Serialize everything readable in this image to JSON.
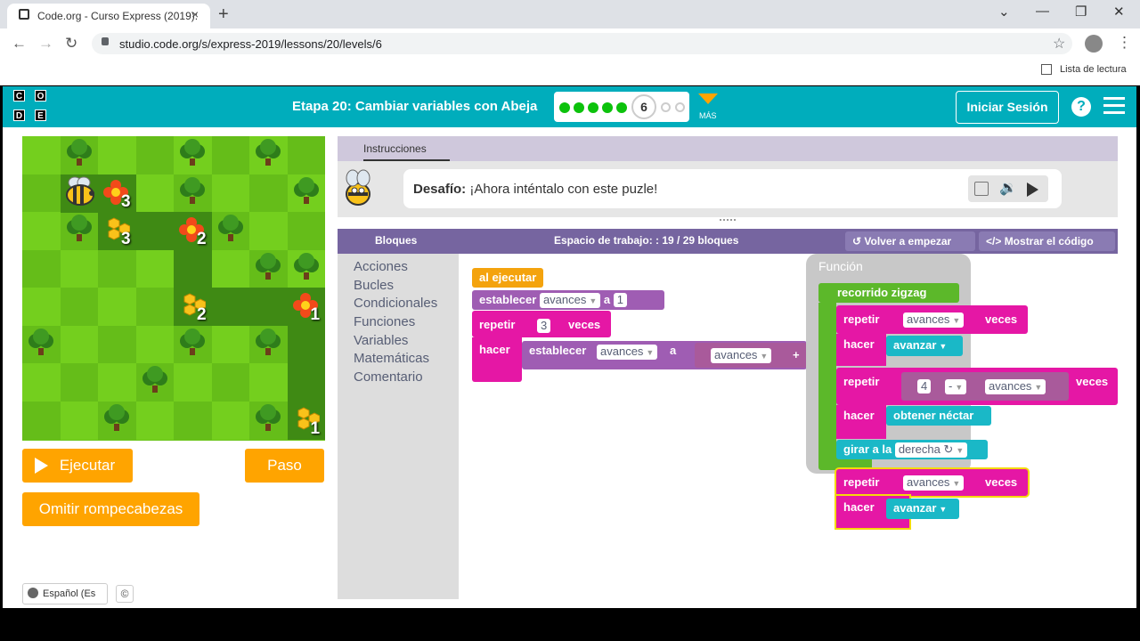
{
  "browser": {
    "tab_title": "Code.org - Curso Express (2019):",
    "tab_close": "×",
    "new_tab": "+",
    "url": "studio.code.org/s/express-2019/lessons/20/levels/6",
    "reading_list": "Lista de lectura",
    "window_controls": [
      "⌄",
      "—",
      "❐",
      "✕"
    ],
    "nav": [
      "←",
      "→",
      "↻"
    ]
  },
  "header": {
    "logo_letters": [
      "C",
      "O",
      "D",
      "E"
    ],
    "stage_title": "Etapa 20: Cambiar variables con Abeja",
    "progress_current": "6",
    "progress_completed": 5,
    "progress_remaining": 2,
    "more_label": "MÁS",
    "signin_label": "Iniciar Sesión",
    "help_label": "?"
  },
  "maze": {
    "counts": [
      "3",
      "3",
      "2",
      "2",
      "1",
      "1"
    ]
  },
  "controls": {
    "run_label": "Ejecutar",
    "step_label": "Paso",
    "skip_label": "Omitir rompecabezas",
    "language": "Español (Es",
    "copyright": "©"
  },
  "instructions": {
    "tab_label": "Instrucciones",
    "challenge_label": "Desafío:",
    "challenge_text": " ¡Ahora inténtalo con este puzle!"
  },
  "workspace": {
    "toolbox_header": "Bloques",
    "title": "Espacio de trabajo: : 19 / 29 bloques",
    "reset_label": "Volver a empezar",
    "show_code_label": "Mostrar el código",
    "categories": [
      "Acciones",
      "Bucles",
      "Condicionales",
      "Funciones",
      "Variables",
      "Matemáticas",
      "Comentario"
    ],
    "function_label": "Función",
    "blocks": {
      "when_run": "al ejecutar",
      "set": "establecer",
      "to": "a",
      "var_name": "avances",
      "set_value": "1",
      "repeat": "repetir",
      "repeat_count": "3",
      "times": "veces",
      "do": "hacer",
      "plus": "+",
      "func_name": "recorrido zigzag",
      "forward": "avanzar",
      "minus_count": "4",
      "minus": "-",
      "get_nectar": "obtener néctar",
      "turn": "girar a la",
      "right": "derecha ↻"
    }
  },
  "colors": {
    "accent": "#00adbc",
    "orange": "#ffa400",
    "purple": "#7665a0",
    "pink": "#e517a5"
  }
}
